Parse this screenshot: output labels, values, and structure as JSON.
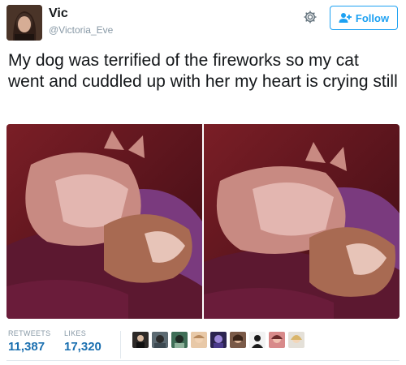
{
  "user": {
    "name": "Vic",
    "handle": "@Victoria_Eve"
  },
  "follow_button": {
    "label": "Follow",
    "icon": "add-user-icon"
  },
  "settings_icon": "gear-icon",
  "tweet": {
    "text": "My dog was terrified of the fireworks so my cat went and cuddled up with her my heart is crying still"
  },
  "media": {
    "count": 2
  },
  "stats": {
    "retweets_label": "RETWEETS",
    "retweets_value": "11,387",
    "likes_label": "LIKES",
    "likes_value": "17,320"
  },
  "likers": {
    "count": 9
  },
  "colors": {
    "accent": "#1da1f2",
    "stat_value": "#1a6fb0",
    "muted": "#8899a6"
  }
}
